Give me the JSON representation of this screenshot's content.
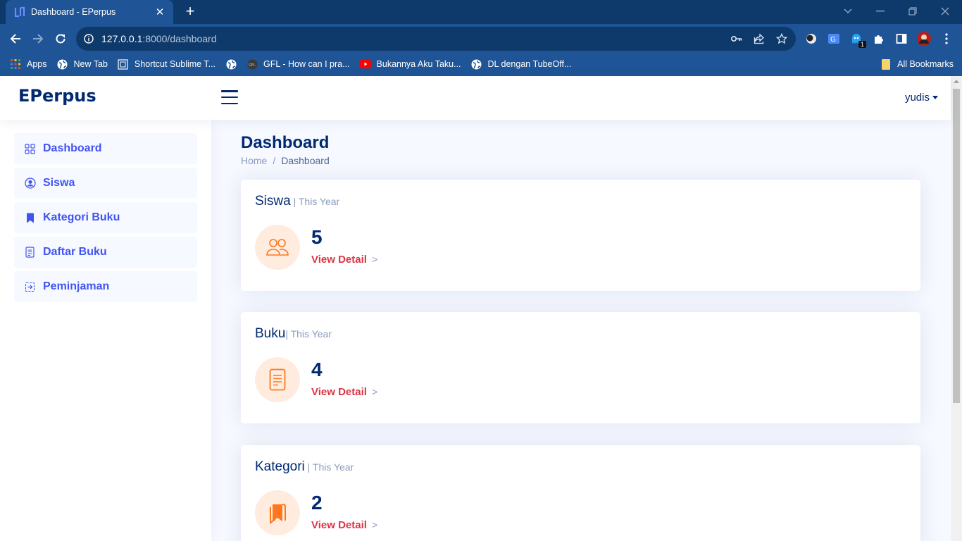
{
  "browser": {
    "tab_title": "Dashboard - EPerpus",
    "url_host": "127.0.0.1",
    "url_rest": ":8000/dashboard",
    "bookmarks": [
      {
        "label": "Apps",
        "icon": "apps-grid-icon"
      },
      {
        "label": "New Tab",
        "icon": "globe-icon"
      },
      {
        "label": "Shortcut Sublime T...",
        "icon": "page-icon"
      },
      {
        "label": "",
        "icon": "globe-icon"
      },
      {
        "label": "GFL - How can I pra...",
        "icon": "gfl-icon"
      },
      {
        "label": "Bukannya Aku Taku...",
        "icon": "youtube-icon"
      },
      {
        "label": "DL dengan TubeOff...",
        "icon": "globe-icon"
      }
    ],
    "all_bookmarks": "All Bookmarks",
    "extension_badge": "1"
  },
  "app": {
    "logo": "EPerpus",
    "user": "yudis"
  },
  "sidebar": {
    "items": [
      {
        "label": "Dashboard",
        "icon": "grid-icon"
      },
      {
        "label": "Siswa",
        "icon": "person-circle-icon"
      },
      {
        "label": "Kategori Buku",
        "icon": "bookmark-icon"
      },
      {
        "label": "Daftar Buku",
        "icon": "document-icon"
      },
      {
        "label": "Peminjaman",
        "icon": "box-arrow-in-icon"
      }
    ]
  },
  "main": {
    "title": "Dashboard",
    "breadcrumb": [
      "Home",
      "/",
      "Dashboard"
    ],
    "cards": [
      {
        "title": "Siswa",
        "subtitle": " | This Year",
        "value": "5",
        "link": "View Detail",
        "arrow": ">",
        "icon": "people-icon"
      },
      {
        "title": "Buku",
        "subtitle": "| This Year",
        "value": "4",
        "link": "View Detail",
        "arrow": ">",
        "icon": "document-icon"
      },
      {
        "title": "Kategori",
        "subtitle": " | This Year",
        "value": "2",
        "link": "View Detail",
        "arrow": ">",
        "icon": "bookmarks-icon"
      }
    ]
  },
  "colors": {
    "primary": "#4154f1",
    "navy": "#012970",
    "accent": "#ff771d",
    "link": "#dc3545",
    "chrome": "#1f5496"
  }
}
